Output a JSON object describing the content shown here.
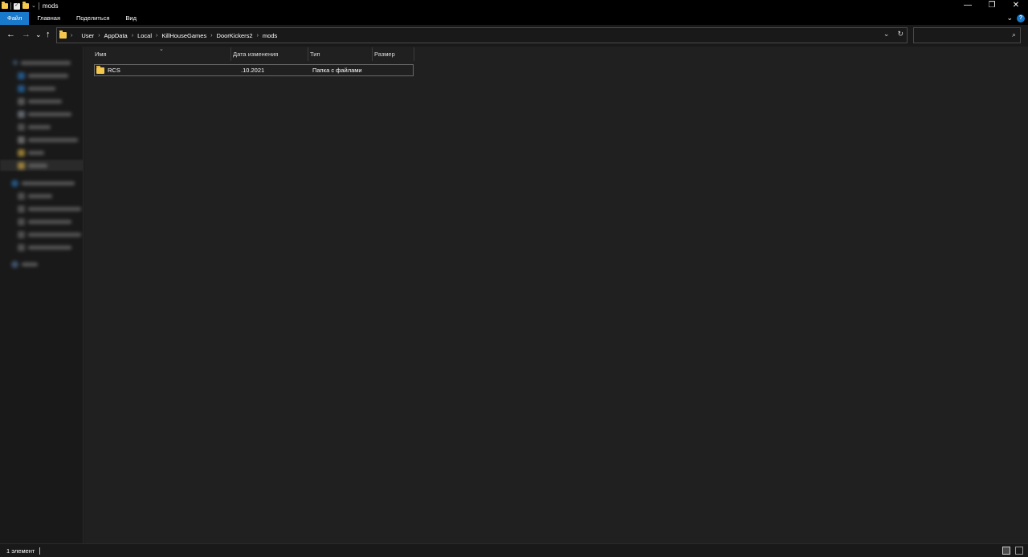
{
  "window": {
    "title": "mods",
    "controls": {
      "minimize": "—",
      "maximize": "❐",
      "close": "✕"
    }
  },
  "ribbon": {
    "tabs": [
      {
        "label": "Файл"
      },
      {
        "label": "Главная"
      },
      {
        "label": "Поделиться"
      },
      {
        "label": "Вид"
      }
    ],
    "help": "?"
  },
  "address": {
    "crumbs": [
      "User",
      "AppData",
      "Local",
      "KillHouseGames",
      "DoorKickers2",
      "mods"
    ]
  },
  "search": {
    "value": "",
    "placeholder": ""
  },
  "columns": {
    "name": "Имя",
    "date": "Дата изменения",
    "type": "Тип",
    "size": "Размер"
  },
  "files": [
    {
      "name": "RCS",
      "date": ".10.2021",
      "type": "Папка с файлами",
      "size": ""
    }
  ],
  "status": {
    "count": "1 элемент"
  },
  "colors": {
    "accent": "#1979ca",
    "folder": "#f4c74e",
    "background": "#202020"
  },
  "icons": {
    "back": "←",
    "forward": "→",
    "recent": "⌄",
    "up": "↑",
    "dropdown": "⌄",
    "refresh": "↻",
    "search": "⌕",
    "chevron": "⌄",
    "crumb_sep": "›",
    "sort": "⌄"
  }
}
